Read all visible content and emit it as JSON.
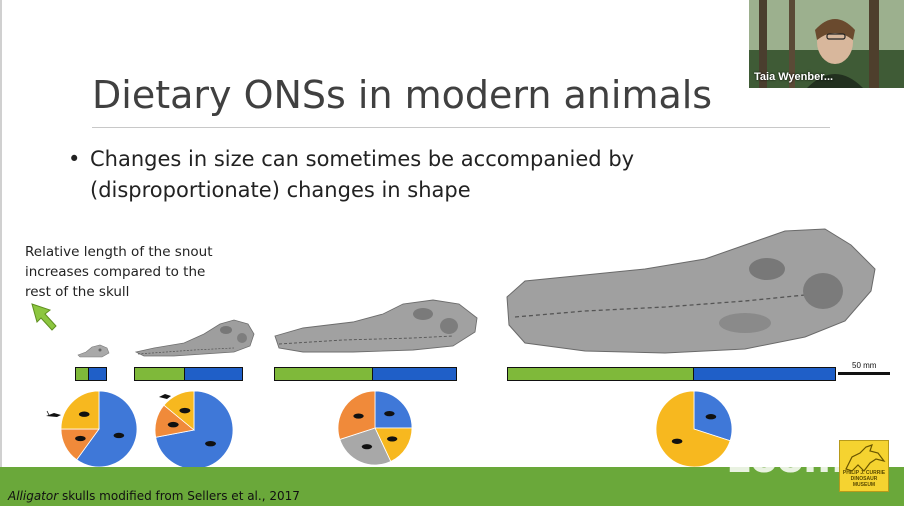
{
  "slide": {
    "title": "Dietary ONSs in modern animals",
    "bullet": "Changes in size can sometimes be accompanied by (disproportionate) changes in shape",
    "note": "Relative length of the snout increases compared to the rest of the skull",
    "scale_label": "50 mm",
    "caption_italic": "Alligator",
    "caption_rest": " skulls modified from Sellers et al., 2017"
  },
  "bars": [
    {
      "green_fraction": 0.42
    },
    {
      "green_fraction": 0.47
    },
    {
      "green_fraction": 0.54
    },
    {
      "green_fraction": 0.57
    }
  ],
  "pies": [
    {
      "blue": 0.6,
      "orange": 0.15,
      "yellow": 0.25
    },
    {
      "blue": 0.72,
      "orange": 0.14,
      "yellow": 0.14
    },
    {
      "blue": 0.25,
      "yellow": 0.18,
      "gray": 0.27,
      "orange": 0.3
    },
    {
      "blue": 0.3,
      "yellow": 0.7
    }
  ],
  "colors": {
    "blue": "#3f78d8",
    "orange": "#f08a3a",
    "yellow": "#f7b81f",
    "gray": "#a8a8a8",
    "bar_green": "#7fb93a",
    "bar_blue": "#1f5fc8",
    "footer_green": "#6aa83a"
  },
  "video": {
    "participant_name": "Taia Wyenber..."
  },
  "watermark": "zoom",
  "logo": {
    "line1": "PHILIP J. CURRIE",
    "line2": "DINOSAUR MUSEUM"
  }
}
